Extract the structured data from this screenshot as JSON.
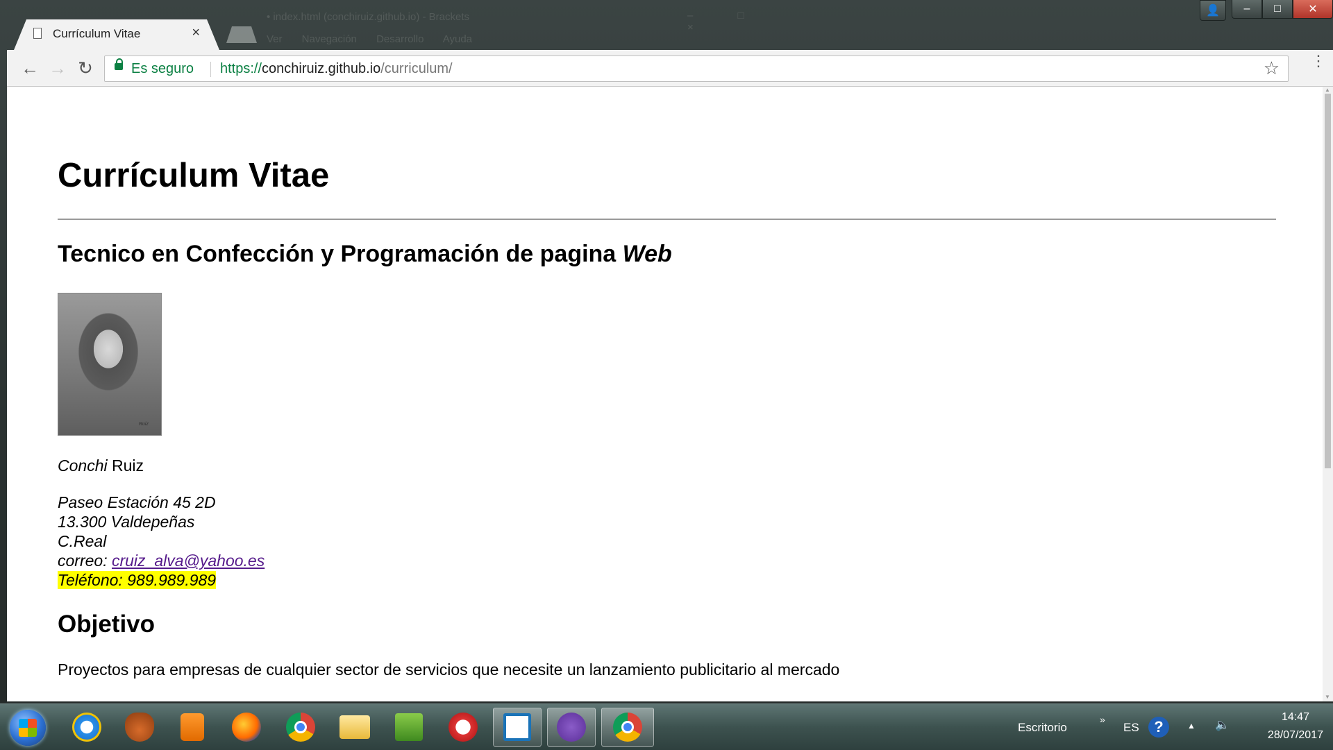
{
  "browser": {
    "tab_title": "Currículum Vitae",
    "tab_close": "×",
    "back": "←",
    "forward": "→",
    "reload": "↻",
    "secure_label": "Es seguro",
    "url_scheme": "https://",
    "url_host": "conchiruiz.github.io",
    "url_path": "/curriculum/",
    "bookmark_star": "☆",
    "menu": "⋮"
  },
  "background_window": {
    "title": "• index.html (conchiruiz.github.io) - Brackets",
    "menu": "Ver Navegación Desarrollo Ayuda",
    "controls": "– □ ×"
  },
  "window_controls": {
    "minimize": "–",
    "maximize": "□",
    "close": "✕",
    "user": "👤"
  },
  "page": {
    "title": "Currículum Vitae",
    "subtitle_main": "Tecnico en Confección y Programación de pagina ",
    "subtitle_em": "Web",
    "portrait_signature": "Ruiz",
    "name_first": "Conchi",
    "name_last": " Ruiz",
    "address_line1": "Paseo Estación 45 2D",
    "address_line2": "13.300 Valdepeñas",
    "address_line3": "C.Real",
    "email_label": "correo: ",
    "email": "cruiz_alva@yahoo.es",
    "phone": "Teléfono: 989.989.989",
    "objective_heading": "Objetivo",
    "objective_text": "Proyectos para empresas de cualquier sector de servicios que necesite un lanzamiento publicitario al mercado"
  },
  "taskbar": {
    "apps": [
      "internet-explorer",
      "gimp",
      "media-player",
      "firefox",
      "chrome",
      "file-explorer",
      "green-app",
      "snipping-tool",
      "brackets",
      "github-desktop",
      "chrome-active"
    ],
    "desktop_label": "Escritorio",
    "language": "ES",
    "help": "?",
    "tray_arrow": "▲",
    "volume": "🔈",
    "overflow": "»",
    "time": "14:47",
    "date": "28/07/2017"
  }
}
